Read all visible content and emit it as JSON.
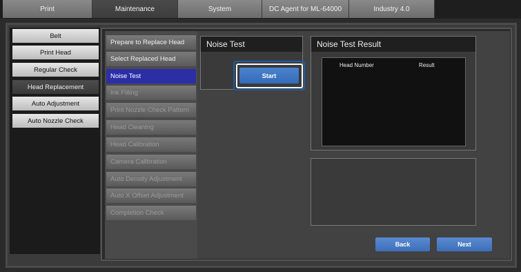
{
  "top_tabs": [
    {
      "label": "Print"
    },
    {
      "label": "Maintenance"
    },
    {
      "label": "System"
    },
    {
      "label": "DC Agent for ML-64000"
    },
    {
      "label": "Industry 4.0"
    }
  ],
  "left_menu": [
    {
      "label": "Belt"
    },
    {
      "label": "Print Head"
    },
    {
      "label": "Regular Check"
    },
    {
      "label": "Head Replacement"
    },
    {
      "label": "Auto Adjustment"
    },
    {
      "label": "Auto Nozzle Check"
    }
  ],
  "steps": [
    {
      "label": "Prepare to Replace Head"
    },
    {
      "label": "Select Replaced Head"
    },
    {
      "label": "Noise Test"
    },
    {
      "label": "Ink Filling"
    },
    {
      "label": "Print Nozzle Check Pattern"
    },
    {
      "label": "Head Cleaning"
    },
    {
      "label": "Head Calibration"
    },
    {
      "label": "Camera Calibration"
    },
    {
      "label": "Auto Density Adjustment"
    },
    {
      "label": "Auto X Offset Adjustment"
    },
    {
      "label": "Completion Check"
    }
  ],
  "noise_test": {
    "title": "Noise Test",
    "start_label": "Start"
  },
  "result": {
    "title": "Noise Test Result",
    "col_head": "Head Number",
    "col_result": "Result"
  },
  "nav": {
    "back_label": "Back",
    "next_label": "Next"
  }
}
